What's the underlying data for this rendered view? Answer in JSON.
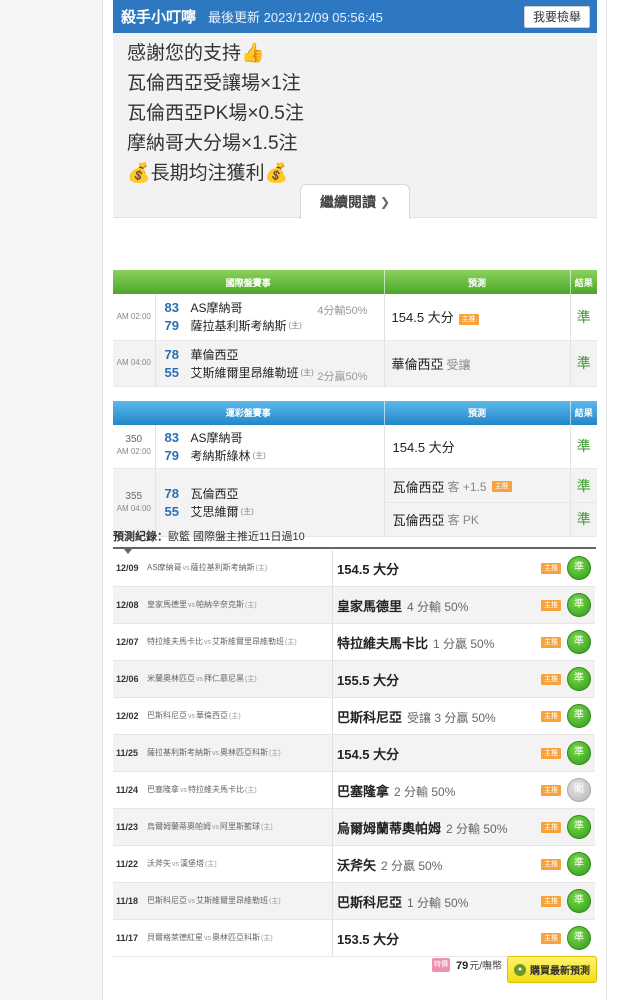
{
  "header": {
    "name": "殺手小叮嚀",
    "updated": "最後更新 2023/12/09 05:56:45",
    "report_label": "我要檢舉"
  },
  "message": {
    "lines": [
      "感謝您的支持👍",
      "瓦倫西亞受讓場×1注",
      "瓦倫西亞PK場×0.5注",
      "摩納哥大分場×1.5注",
      "💰長期均注獲利💰"
    ],
    "read_more": "繼續閱讀"
  },
  "intl_table": {
    "headers": [
      "國際盤賽事",
      "預測",
      "結果"
    ],
    "rows": [
      {
        "time": "AM 02:00",
        "team1_no": "83",
        "team1": "AS摩納哥",
        "team2_no": "79",
        "team2": "薩拉基利斯考納斯",
        "team2_host": "(主)",
        "handicap": "4分輸50%",
        "pred": "154.5 大分",
        "pred_sub": "",
        "badge": "主推",
        "result": "準"
      },
      {
        "time": "AM 04:00",
        "team1_no": "78",
        "team1": "華倫西亞",
        "team2_no": "55",
        "team2": "艾斯維爾里昂維勒班",
        "team2_host": "(主)",
        "handicap": "2分贏50%",
        "pred": "華倫西亞",
        "pred_sub": "受讓",
        "badge": "",
        "result": "準"
      }
    ]
  },
  "lottery_table": {
    "headers": [
      "運彩盤賽事",
      "預測",
      "結果"
    ],
    "rows": [
      {
        "num": "350",
        "time": "AM 02:00",
        "team1_no": "83",
        "team1": "AS摩納哥",
        "team2_no": "79",
        "team2": "考納斯綠林",
        "team2_host": "(主)",
        "preds": [
          {
            "text": "154.5 大分",
            "sub": "",
            "badge": "",
            "result": "準"
          }
        ]
      },
      {
        "num": "355",
        "time": "AM 04:00",
        "team1_no": "78",
        "team1": "瓦倫西亞",
        "team2_no": "55",
        "team2": "艾思維爾",
        "team2_host": "(主)",
        "preds": [
          {
            "text": "瓦倫西亞",
            "sub": "客 +1.5",
            "badge": "主推",
            "result": "準"
          },
          {
            "text": "瓦倫西亞",
            "sub": "客 PK",
            "badge": "",
            "result": "準"
          }
        ]
      }
    ]
  },
  "record": {
    "label": "預測紀錄：",
    "desc": "歐籃 國際盤主推近11日過10",
    "rows": [
      {
        "date": "12/09",
        "away": "AS摩納哥",
        "vs": "vs",
        "home": "薩拉基利斯考納斯",
        "host": "(主)",
        "pred": "154.5 大分",
        "sub": "",
        "badge": "主推",
        "result": "準",
        "ok": true
      },
      {
        "date": "12/08",
        "away": "皇家馬德里",
        "vs": "vs",
        "home": "帕納辛奈克斯",
        "host": "(主)",
        "pred": "皇家馬德里",
        "sub": "4 分輸 50%",
        "badge": "主推",
        "result": "準",
        "ok": true
      },
      {
        "date": "12/07",
        "away": "特拉維夫馬卡比",
        "vs": "vs",
        "home": "艾斯維爾里昂維勒班",
        "host": "(主)",
        "pred": "特拉維夫馬卡比",
        "sub": "1 分贏 50%",
        "badge": "主推",
        "result": "準",
        "ok": true
      },
      {
        "date": "12/06",
        "away": "米蘭奧林匹亞",
        "vs": "vs",
        "home": "拜仁慕尼黑",
        "host": "(主)",
        "pred": "155.5 大分",
        "sub": "",
        "badge": "主推",
        "result": "準",
        "ok": true
      },
      {
        "date": "12/02",
        "away": "巴斯科尼亞",
        "vs": "vs",
        "home": "華倫西亞",
        "host": "(主)",
        "pred": "巴斯科尼亞",
        "sub": "受讓 3 分贏 50%",
        "badge": "主推",
        "result": "準",
        "ok": true
      },
      {
        "date": "11/25",
        "away": "薩拉基利斯考納斯",
        "vs": "vs",
        "home": "奧林匹亞科斯",
        "host": "(主)",
        "pred": "154.5 大分",
        "sub": "",
        "badge": "主推",
        "result": "準",
        "ok": true
      },
      {
        "date": "11/24",
        "away": "巴塞隆拿",
        "vs": "vs",
        "home": "特拉維夫馬卡比",
        "host": "(主)",
        "pred": "巴塞隆拿",
        "sub": "2 分輸 50%",
        "badge": "主推",
        "result": "闖",
        "ok": false
      },
      {
        "date": "11/23",
        "away": "烏爾姆蘭蒂奧帕姆",
        "vs": "vs",
        "home": "阿里斯籃球",
        "host": "(主)",
        "pred": "烏爾姆蘭蒂奧帕姆",
        "sub": "2 分輸 50%",
        "badge": "主推",
        "result": "準",
        "ok": true
      },
      {
        "date": "11/22",
        "away": "沃斧矢",
        "vs": "vs",
        "home": "漢堡塔",
        "host": "(主)",
        "pred": "沃斧矢",
        "sub": "2 分贏 50%",
        "badge": "主推",
        "result": "準",
        "ok": true
      },
      {
        "date": "11/18",
        "away": "巴斯科尼亞",
        "vs": "vs",
        "home": "艾斯維爾里昂維勒班",
        "host": "(主)",
        "pred": "巴斯科尼亞",
        "sub": "1 分輸 50%",
        "badge": "主推",
        "result": "準",
        "ok": true
      },
      {
        "date": "11/17",
        "away": "貝爾格萊德紅星",
        "vs": "vs",
        "home": "奧林匹亞科斯",
        "host": "(主)",
        "pred": "153.5 大分",
        "sub": "",
        "badge": "主推",
        "result": "準",
        "ok": true
      }
    ]
  },
  "footer": {
    "coin_label": "特價",
    "price": "79",
    "unit": "元/嘸幣",
    "buy_label": "購買最新預測"
  },
  "colors": {
    "header_blue": "#2e78c2",
    "green_header": "#4ca62b",
    "blue_header": "#2386c9",
    "result_green": "#3a9a2c",
    "badge_orange": "#f7a23b"
  }
}
